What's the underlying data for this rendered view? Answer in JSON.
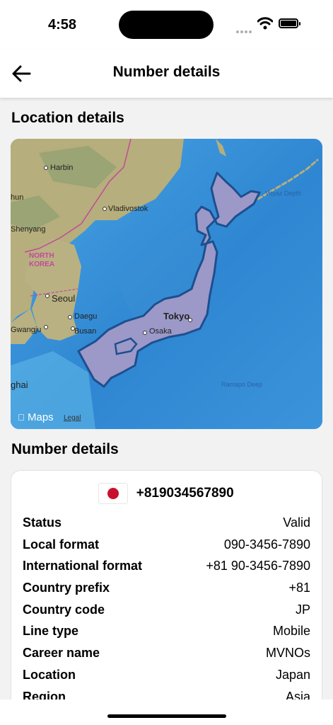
{
  "status_bar": {
    "time": "4:58"
  },
  "header": {
    "title": "Number details"
  },
  "location_section": {
    "title": "Location details"
  },
  "map": {
    "attribution": "Maps",
    "legal": "Legal",
    "labels": {
      "harbin": "Harbin",
      "vladivostok": "Vladivostok",
      "shenyang": "Shenyang",
      "north_korea_1": "NORTH",
      "north_korea_2": "KOREA",
      "seoul": "Seoul",
      "daegu": "Daegu",
      "busan": "Busan",
      "gwangju": "Gwangju",
      "tokyo": "Tokyo",
      "osaka": "Osaka",
      "vityaz": "Vityaz Depth",
      "ramapo": "Ramapo Deep",
      "hun": "hun",
      "ghai": "ghai"
    }
  },
  "details_section": {
    "title": "Number details"
  },
  "number_card": {
    "phone_number": "+819034567890",
    "rows": [
      {
        "label": "Status",
        "value": "Valid"
      },
      {
        "label": "Local format",
        "value": "090-3456-7890"
      },
      {
        "label": "International format",
        "value": "+81 90-3456-7890"
      },
      {
        "label": "Country prefix",
        "value": "+81"
      },
      {
        "label": "Country code",
        "value": "JP"
      },
      {
        "label": "Line type",
        "value": "Mobile"
      },
      {
        "label": "Career name",
        "value": "MVNOs"
      },
      {
        "label": "Location",
        "value": "Japan"
      },
      {
        "label": "Region",
        "value": "Asia"
      }
    ]
  },
  "colors": {
    "highlight_fill": "#9c98c8",
    "highlight_stroke": "#1d4f8e",
    "flag_red": "#c8102e"
  }
}
